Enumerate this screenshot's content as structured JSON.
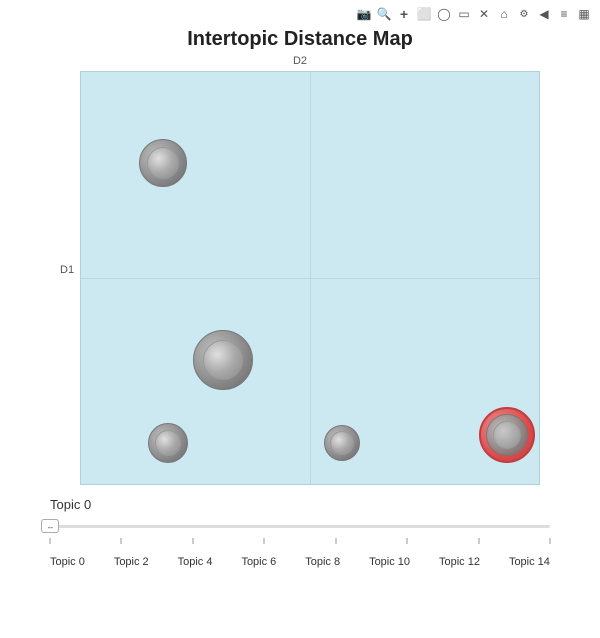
{
  "toolbar": {
    "icons": [
      "📷",
      "🔍",
      "+",
      "□",
      "◯",
      "▭",
      "✕",
      "⌂",
      "⚙",
      "◀",
      "≡",
      "▦"
    ]
  },
  "chart": {
    "title": "Intertopic Distance Map",
    "d1_label": "D1",
    "d2_label": "D2",
    "bubbles": [
      {
        "id": "b1",
        "x": 18,
        "y": 22,
        "outer_r": 24,
        "inner_r": 16,
        "selected": false
      },
      {
        "id": "b2",
        "x": 31,
        "y": 70,
        "outer_r": 30,
        "inner_r": 20,
        "selected": false
      },
      {
        "id": "b3",
        "x": 19,
        "y": 90,
        "outer_r": 20,
        "inner_r": 13,
        "selected": false
      },
      {
        "id": "b4",
        "x": 56,
        "y": 90,
        "outer_r": 18,
        "inner_r": 12,
        "selected": false
      },
      {
        "id": "b5",
        "x": 93,
        "y": 88,
        "outer_r": 28,
        "inner_r": 18,
        "selected": true
      }
    ]
  },
  "slider": {
    "label": "Topic 0",
    "value": 0,
    "min": 0,
    "max": 14,
    "step": 2,
    "topics": [
      "Topic 0",
      "Topic 2",
      "Topic 4",
      "Topic 6",
      "Topic 8",
      "Topic 10",
      "Topic 12",
      "Topic 14"
    ]
  }
}
